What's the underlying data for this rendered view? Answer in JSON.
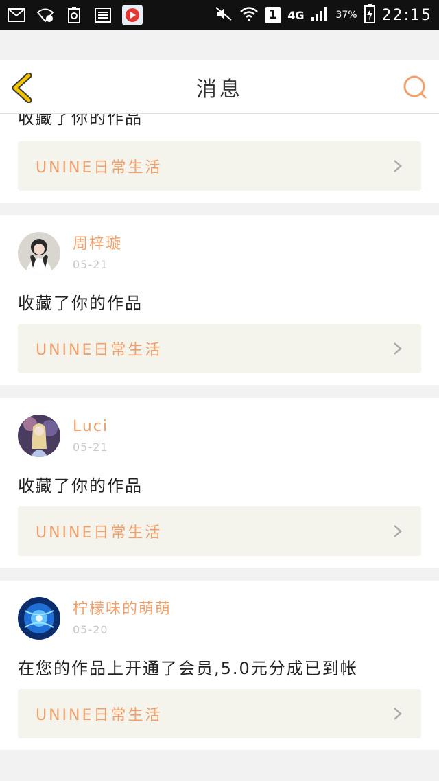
{
  "status_bar": {
    "network": "4G",
    "sim": "1",
    "battery": "37%",
    "time": "22:15"
  },
  "header": {
    "title": "消息",
    "back_icon": "chevron-left-icon",
    "search_icon": "search-icon",
    "accent_color": "#f0a06a",
    "back_color": "#f2c300"
  },
  "partial_item": {
    "message": "收藏了你的作品",
    "work_title": "UNINE日常生活"
  },
  "notifications": [
    {
      "user": "周梓璇",
      "date": "05-21",
      "message": "收藏了你的作品",
      "work_title": "UNINE日常生活"
    },
    {
      "user": "Luci",
      "date": "05-21",
      "message": "收藏了你的作品",
      "work_title": "UNINE日常生活"
    },
    {
      "user": "柠檬味的萌萌",
      "date": "05-20",
      "message": "在您的作品上开通了会员,5.0元分成已到帐",
      "work_title": "UNINE日常生活"
    }
  ]
}
